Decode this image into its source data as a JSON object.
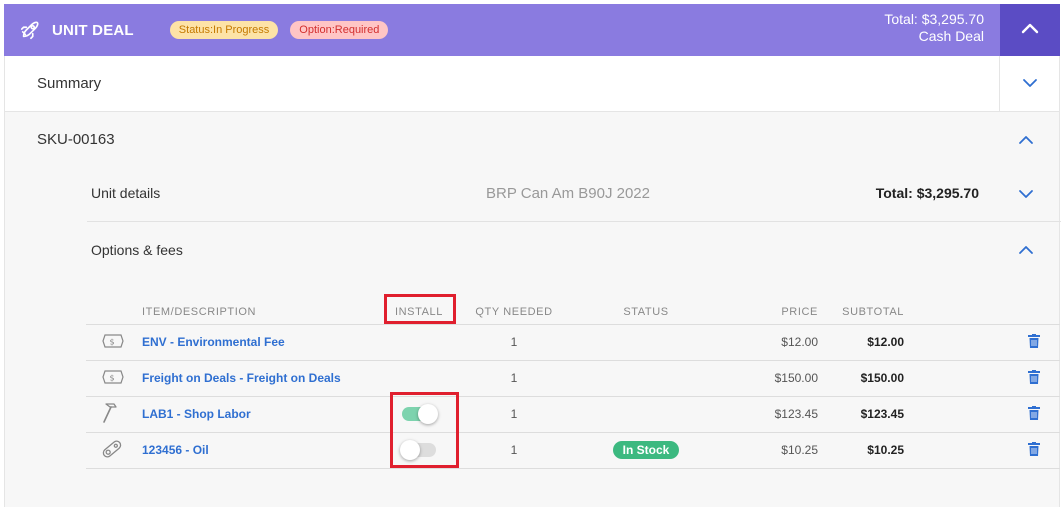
{
  "header": {
    "title": "UNIT DEAL",
    "status_badge": "Status:In Progress",
    "option_badge": "Option:Required",
    "total": "Total: $3,295.70",
    "deal_type": "Cash Deal",
    "icon": "rocket-icon",
    "color_bg": "#8a7be0",
    "color_collapse": "#5b4cc4"
  },
  "summary": {
    "label": "Summary"
  },
  "sku": {
    "label": "SKU-00163"
  },
  "unit_details": {
    "label": "Unit details",
    "model": "BRP Can Am B90J 2022",
    "total_label": "Total:",
    "total_value": "$3,295.70"
  },
  "options": {
    "label": "Options & fees",
    "columns": {
      "desc": "ITEM/DESCRIPTION",
      "install": "INSTALL",
      "qty": "QTY NEEDED",
      "status": "STATUS",
      "price": "PRICE",
      "subtotal": "SUBTOTAL"
    },
    "rows": [
      {
        "icon": "fee-tag-icon",
        "desc": "ENV - Environmental Fee",
        "install": null,
        "qty": "1",
        "status": "",
        "price": "$12.00",
        "subtotal": "$12.00"
      },
      {
        "icon": "fee-tag-icon",
        "desc": "Freight on Deals - Freight on Deals",
        "install": null,
        "qty": "1",
        "status": "",
        "price": "$150.00",
        "subtotal": "$150.00"
      },
      {
        "icon": "hammer-icon",
        "desc": "LAB1 - Shop Labor",
        "install": "on",
        "qty": "1",
        "status": "",
        "price": "$123.45",
        "subtotal": "$123.45"
      },
      {
        "icon": "part-icon",
        "desc": "123456 - Oil",
        "install": "off",
        "qty": "1",
        "status": "In Stock",
        "price": "$10.25",
        "subtotal": "$10.25"
      }
    ]
  },
  "colors": {
    "accent_blue": "#2f6fd1",
    "in_stock_green": "#3cb980",
    "highlight_red": "#e01f2e"
  }
}
